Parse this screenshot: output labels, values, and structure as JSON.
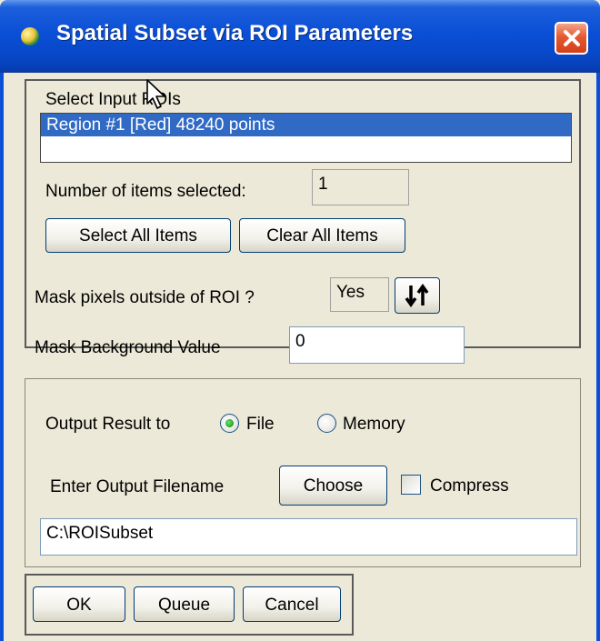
{
  "window": {
    "title": "Spatial Subset via ROI Parameters",
    "close_icon": "close-icon"
  },
  "roi_section": {
    "label": "Select Input ROIs",
    "list_items": [
      "Region #1 [Red] 48240 points"
    ],
    "items_selected_label": "Number of items selected:",
    "items_selected_value": "1",
    "select_all_label": "Select All Items",
    "clear_all_label": "Clear All Items"
  },
  "mask": {
    "label": "Mask pixels outside of ROI ?",
    "value": "Yes",
    "toggle_icon": "swap-arrows-icon",
    "background_label": "Mask Background Value",
    "background_value": "0"
  },
  "output": {
    "label": "Output Result to",
    "file_label": "File",
    "memory_label": "Memory",
    "selected": "File",
    "filename_label": "Enter Output Filename",
    "choose_label": "Choose",
    "compress_label": "Compress",
    "compress_checked": false,
    "filename_value": "C:\\ROISubset"
  },
  "actions": {
    "ok_label": "OK",
    "queue_label": "Queue",
    "cancel_label": "Cancel"
  },
  "colors": {
    "titlebar": "#0a4fd6",
    "dialog_bg": "#ece9d8",
    "selection": "#316ac5",
    "close_button": "#d2401b"
  }
}
